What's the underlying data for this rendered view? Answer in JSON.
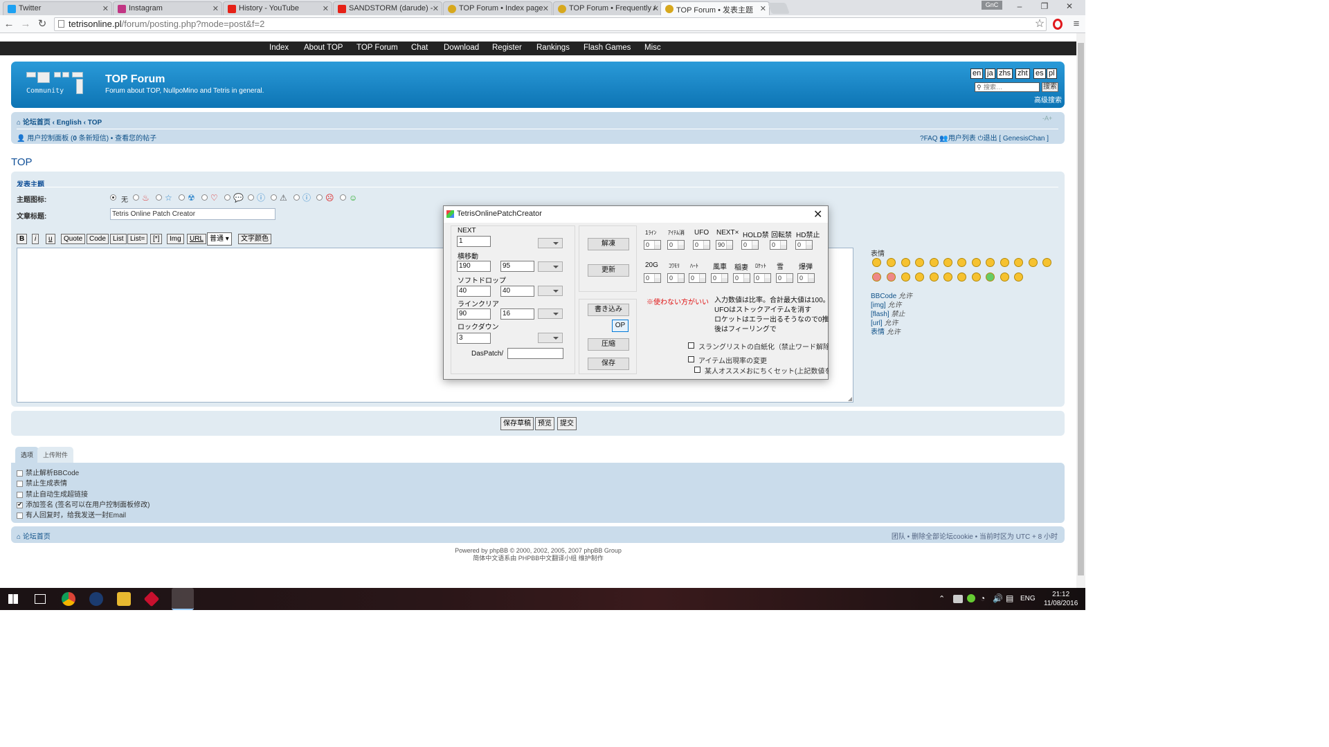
{
  "browser": {
    "tabs": [
      {
        "label": "Twitter",
        "color": "#1da1f2"
      },
      {
        "label": "Instagram",
        "color": "#c13584"
      },
      {
        "label": "History - YouTube",
        "color": "#e62117"
      },
      {
        "label": "SANDSTORM (darude) - Y",
        "color": "#e62117"
      },
      {
        "label": "TOP Forum • Index page",
        "color": "#d7a81d"
      },
      {
        "label": "TOP Forum • Frequently A",
        "color": "#d7a81d"
      },
      {
        "label": "TOP Forum • 发表主题",
        "color": "#d7a81d"
      }
    ],
    "profile": "GnC",
    "url_host": "tetrisonline.pl",
    "url_path": "/forum/posting.php?mode=post&f=2"
  },
  "nav": [
    "Index",
    "About TOP",
    "TOP Forum",
    "Chat",
    "Download",
    "Register",
    "Rankings",
    "Flash Games",
    "Misc"
  ],
  "header": {
    "logo_text": "Community",
    "title": "TOP Forum",
    "description": "Forum about TOP, NullpoMino and Tetris in general.",
    "languages": [
      "en",
      "ja",
      "zhs",
      "zht",
      "es",
      "pl"
    ],
    "search_placeholder": "搜索…",
    "search_button": "搜索",
    "advanced_search": "高级搜索"
  },
  "breadcrumb": {
    "home": "论坛首页",
    "sep1": "‹",
    "crumb1": "English",
    "sep2": "‹",
    "crumb2": "TOP",
    "resize": "-A+",
    "ucp": "用户控制面板",
    "pm_prefix": "(",
    "pm_count": "0",
    "pm_suffix": "条新短信) • 查看您的帖子",
    "faq": "FAQ",
    "members": "用户列表",
    "logout": "退出 [ GenesisChan ]"
  },
  "post": {
    "forum_title": "TOP",
    "heading": "发表主题",
    "icon_label": "主题图标:",
    "icon_none": "无",
    "subject_label": "文章标题:",
    "subject_value": "Tetris Online Patch Creator",
    "bbcode_buttons": [
      "B",
      "i",
      "u",
      "Quote",
      "Code",
      "List",
      "List=",
      "[*]",
      "Img",
      "URL"
    ],
    "font_size": "普通",
    "font_color": "文字颜色",
    "smilies_label": "表情",
    "bb_status": [
      {
        "name": "BBCode",
        "state": "允许"
      },
      {
        "name": "[img]",
        "state": "允许"
      },
      {
        "name": "[flash]",
        "state": "禁止"
      },
      {
        "name": "[url]",
        "state": "允许"
      },
      {
        "name": "表情",
        "state": "允许"
      }
    ],
    "save_draft": "保存草稿",
    "preview": "预览",
    "submit": "提交"
  },
  "options": {
    "tabs": [
      "选项",
      "上传附件"
    ],
    "checkboxes": [
      {
        "label": "禁止解析BBCode",
        "checked": false
      },
      {
        "label": "禁止生成表情",
        "checked": false
      },
      {
        "label": "禁止自动生成超链接",
        "checked": false
      },
      {
        "label": "添加签名 (签名可以在用户控制面板修改)",
        "checked": true
      },
      {
        "label": "有人回复时，给我发送一封Email",
        "checked": false
      }
    ]
  },
  "footer": {
    "home": "论坛首页",
    "right": "团队 • 删除全部论坛cookie • 当前时区为 UTC + 8 小时",
    "powered": "Powered by phpBB © 2000, 2002, 2005, 2007 phpBB Group",
    "translated": "简体中文语系由 PHPBB中文翻译小组 维护制作"
  },
  "dialog": {
    "title": "TetrisOnlinePatchCreator",
    "fields": {
      "next_label": "NEXT",
      "next_value": "1",
      "yoko_label": "横移動",
      "yoko_a": "190",
      "yoko_b": "95",
      "soft_label": "ソフトドロップ",
      "soft_a": "40",
      "soft_b": "40",
      "line_label": "ラインクリア",
      "line_a": "90",
      "line_b": "16",
      "lock_label": "ロックダウン",
      "lock_value": "3",
      "das_label": "DasPatch/",
      "das_value": ""
    },
    "buttons": {
      "decode": "解凍",
      "update": "更新",
      "write": "書き込み",
      "op": "OP",
      "compress": "圧縮",
      "save": "保存"
    },
    "spinners_row1": [
      {
        "label": "1ﾗｲﾝ",
        "value": "0"
      },
      {
        "label": "ｱｲﾃﾑ消",
        "value": "0"
      },
      {
        "label": "UFO",
        "value": "0"
      },
      {
        "label": "NEXT×",
        "value": "90"
      },
      {
        "label": "HOLD禁",
        "value": "0"
      },
      {
        "label": "回転禁",
        "value": "0"
      },
      {
        "label": "HD禁止",
        "value": "0"
      }
    ],
    "spinners_row2": [
      {
        "label": "20G",
        "value": "0"
      },
      {
        "label": "ｺﾜﾓﾘ",
        "value": "0"
      },
      {
        "label": "ﾊｰﾄ",
        "value": "0"
      },
      {
        "label": "風車",
        "value": "0"
      },
      {
        "label": "稲妻",
        "value": "0"
      },
      {
        "label": "ﾛｹｯﾄ",
        "value": "0"
      },
      {
        "label": "雪",
        "value": "0"
      },
      {
        "label": "爆弾",
        "value": "0"
      }
    ],
    "warning": "※使わない方がいい",
    "notes": [
      "入力数値は比率。合計最大値は100。",
      "UFOはストックアイテムを消す",
      "ロケットはエラー出るそうなので0推",
      "後はフィーリングで"
    ],
    "checkboxes": [
      "スラングリストの白紙化（禁止ワード解除",
      "アイテム出現率の変更",
      "某人オススメおにちくセット(上記数値を"
    ]
  },
  "taskbar": {
    "lang": "ENG",
    "time": "21:12",
    "date": "11/08/2016"
  }
}
